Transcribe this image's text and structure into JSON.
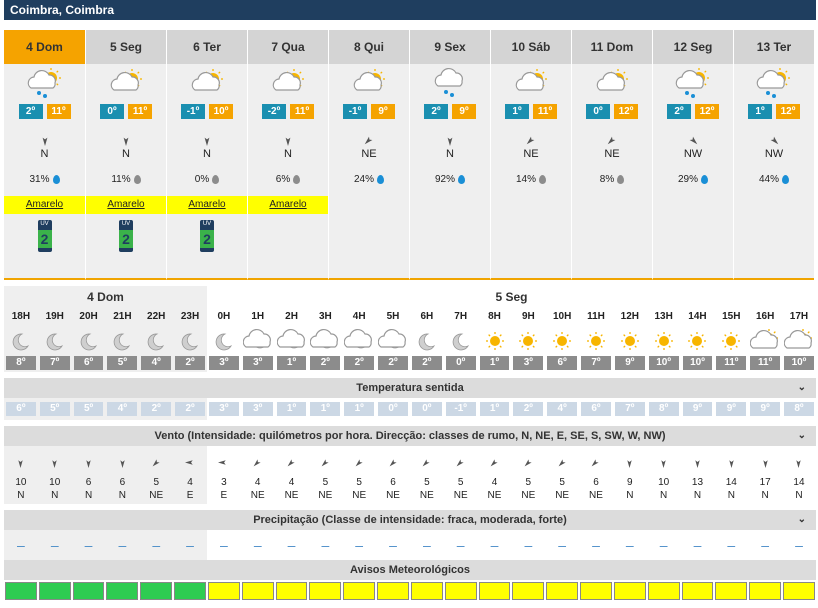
{
  "title": "Coimbra, Coimbra",
  "colors": {
    "header": "#1f3e5f",
    "active": "#f5a300",
    "tmin": "#1a8fb0",
    "tmax": "#f5a300",
    "warn_yellow": "#ffff00",
    "warn_green": "#2ecc51",
    "rain_blue": "#1a8fd6",
    "rain_gray": "#8c8c8c"
  },
  "days": [
    {
      "label": "4 Dom",
      "icon": "rain-cloud-sun-icon",
      "tmin": "2º",
      "tmax": "11º",
      "wind_dir": "N",
      "rain": "31%",
      "rain_drop": "blue",
      "warning": "Amarelo",
      "uv": "2",
      "uv_label": "UV"
    },
    {
      "label": "5 Seg",
      "icon": "cloud-sun-icon",
      "tmin": "0º",
      "tmax": "11º",
      "wind_dir": "N",
      "rain": "11%",
      "rain_drop": "gray",
      "warning": "Amarelo",
      "uv": "2",
      "uv_label": "UV"
    },
    {
      "label": "6 Ter",
      "icon": "cloud-sun-icon",
      "tmin": "-1º",
      "tmax": "10º",
      "wind_dir": "N",
      "rain": "0%",
      "rain_drop": "gray",
      "warning": "Amarelo",
      "uv": "2",
      "uv_label": "UV"
    },
    {
      "label": "7 Qua",
      "icon": "cloud-sun-icon",
      "tmin": "-2º",
      "tmax": "11º",
      "wind_dir": "N",
      "rain": "6%",
      "rain_drop": "gray",
      "warning": "Amarelo",
      "uv": "",
      "uv_label": ""
    },
    {
      "label": "8 Qui",
      "icon": "cloud-sun-icon",
      "tmin": "-1º",
      "tmax": "9º",
      "wind_dir": "NE",
      "rain": "24%",
      "rain_drop": "blue",
      "warning": "",
      "uv": "",
      "uv_label": ""
    },
    {
      "label": "9 Sex",
      "icon": "rain-cloud-icon",
      "tmin": "2º",
      "tmax": "9º",
      "wind_dir": "N",
      "rain": "92%",
      "rain_drop": "blue",
      "warning": "",
      "uv": "",
      "uv_label": ""
    },
    {
      "label": "10 Sáb",
      "icon": "cloud-sun-icon",
      "tmin": "1º",
      "tmax": "11º",
      "wind_dir": "NE",
      "rain": "14%",
      "rain_drop": "gray",
      "warning": "",
      "uv": "",
      "uv_label": ""
    },
    {
      "label": "11 Dom",
      "icon": "cloud-sun-icon",
      "tmin": "0º",
      "tmax": "12º",
      "wind_dir": "NE",
      "rain": "8%",
      "rain_drop": "gray",
      "warning": "",
      "uv": "",
      "uv_label": ""
    },
    {
      "label": "12 Seg",
      "icon": "rain-cloud-sun-icon",
      "tmin": "2º",
      "tmax": "12º",
      "wind_dir": "NW",
      "rain": "29%",
      "rain_drop": "blue",
      "warning": "",
      "uv": "",
      "uv_label": ""
    },
    {
      "label": "13 Ter",
      "icon": "rain-cloud-sun-icon",
      "tmin": "1º",
      "tmax": "12º",
      "wind_dir": "NW",
      "rain": "44%",
      "rain_drop": "blue",
      "warning": "",
      "uv": "",
      "uv_label": ""
    }
  ],
  "hourly": {
    "day_labels": [
      "4 Dom",
      "5 Seg"
    ],
    "hours": [
      "18H",
      "19H",
      "20H",
      "21H",
      "22H",
      "23H",
      "0H",
      "1H",
      "2H",
      "3H",
      "4H",
      "5H",
      "6H",
      "7H",
      "8H",
      "9H",
      "10H",
      "11H",
      "12H",
      "13H",
      "14H",
      "15H",
      "16H",
      "17H"
    ],
    "icons": [
      "moon-icon",
      "moon-icon",
      "moon-icon",
      "moon-icon",
      "moon-icon",
      "moon-icon",
      "moon-icon",
      "moon-cloud-icon",
      "moon-cloud-icon",
      "moon-cloud-icon",
      "moon-cloud-icon",
      "moon-cloud-icon",
      "moon-icon",
      "moon-icon",
      "sun-icon",
      "sun-icon",
      "sun-icon",
      "sun-icon",
      "sun-icon",
      "sun-icon",
      "sun-icon",
      "sun-icon",
      "sun-cloud-icon",
      "sun-cloud-icon"
    ],
    "temps": [
      "8º",
      "7º",
      "6º",
      "5º",
      "4º",
      "2º",
      "3º",
      "3º",
      "1º",
      "2º",
      "2º",
      "2º",
      "2º",
      "0º",
      "1º",
      "3º",
      "6º",
      "7º",
      "9º",
      "10º",
      "10º",
      "11º",
      "11º",
      "10º"
    ],
    "feels_title": "Temperatura sentida",
    "feels": [
      "6º",
      "5º",
      "5º",
      "4º",
      "2º",
      "2º",
      "3º",
      "3º",
      "1º",
      "1º",
      "1º",
      "0º",
      "0º",
      "-1º",
      "1º",
      "2º",
      "4º",
      "6º",
      "7º",
      "8º",
      "9º",
      "9º",
      "9º",
      "8º"
    ],
    "wind_title": "Vento (Intensidade: quilómetros por hora. Direcção: classes de rumo, N, NE, E, SE, S, SW, W, NW)",
    "wind_speed": [
      "10",
      "10",
      "6",
      "6",
      "5",
      "4",
      "3",
      "4",
      "4",
      "5",
      "5",
      "6",
      "5",
      "5",
      "4",
      "5",
      "5",
      "6",
      "9",
      "10",
      "13",
      "14",
      "17",
      "14"
    ],
    "wind_dir": [
      "N",
      "N",
      "N",
      "N",
      "NE",
      "E",
      "E",
      "NE",
      "NE",
      "NE",
      "NE",
      "NE",
      "NE",
      "NE",
      "NE",
      "NE",
      "NE",
      "NE",
      "N",
      "N",
      "N",
      "N",
      "N",
      "N"
    ],
    "precip_title": "Precipitação (Classe de intensidade: fraca, moderada, forte)",
    "precip": [
      "–",
      "–",
      "–",
      "–",
      "–",
      "–",
      "–",
      "–",
      "–",
      "–",
      "–",
      "–",
      "–",
      "–",
      "–",
      "–",
      "–",
      "–",
      "–",
      "–",
      "–",
      "–",
      "–",
      "–"
    ],
    "warn_title": "Avisos Meteorológicos",
    "warn_colors": [
      "green",
      "green",
      "green",
      "green",
      "green",
      "green",
      "yellow",
      "yellow",
      "yellow",
      "yellow",
      "yellow",
      "yellow",
      "yellow",
      "yellow",
      "yellow",
      "yellow",
      "yellow",
      "yellow",
      "yellow",
      "yellow",
      "yellow",
      "yellow",
      "yellow",
      "yellow"
    ]
  }
}
